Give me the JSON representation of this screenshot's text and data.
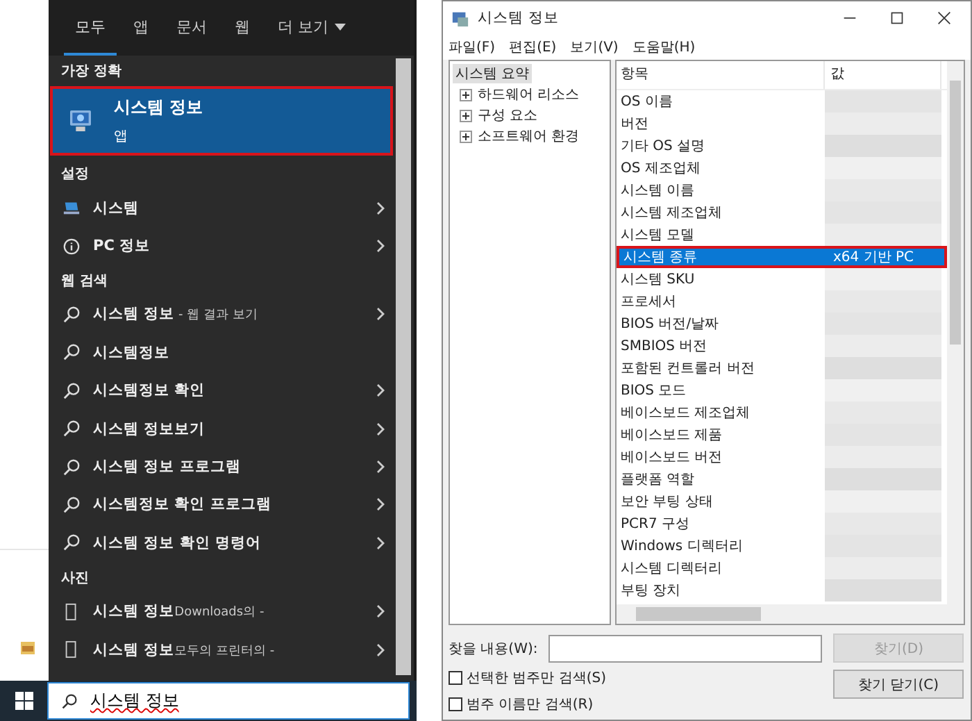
{
  "start_menu": {
    "tabs": [
      {
        "label": "모두",
        "selected": true,
        "kind": "plain"
      },
      {
        "label": "앱",
        "selected": false,
        "kind": "plain"
      },
      {
        "label": "문서",
        "selected": false,
        "kind": "plain"
      },
      {
        "label": "웹",
        "selected": false,
        "kind": "plain"
      },
      {
        "label": "더 보기",
        "selected": false,
        "kind": "menu"
      }
    ],
    "sections": [
      {
        "title": "가장 정확",
        "items": [
          {
            "kind": "app",
            "title": "시스템 정보",
            "subtitle": "앱",
            "highlighted": true
          }
        ]
      },
      {
        "title": "설정",
        "items": [
          {
            "kind": "system",
            "title": "시스템",
            "chevron": true
          },
          {
            "kind": "info",
            "title": "PC 정보",
            "chevron": true
          }
        ]
      },
      {
        "title": "웹 검색",
        "items": [
          {
            "kind": "search",
            "title": "시스템 정보",
            "suffix": " - 웹 결과 보기",
            "chevron": true
          },
          {
            "kind": "search",
            "title": "시스템정보",
            "chevron": false
          },
          {
            "kind": "search",
            "title": "시스템정보 확인",
            "chevron": true
          },
          {
            "kind": "search",
            "title": "시스템 정보보기",
            "chevron": true
          },
          {
            "kind": "search",
            "title": "시스템 정보 프로그램",
            "chevron": true
          },
          {
            "kind": "search",
            "title": "시스템정보 확인 프로그램",
            "chevron": true
          },
          {
            "kind": "search",
            "title": "시스템 정보 확인 명령어",
            "chevron": true
          }
        ]
      },
      {
        "title": "사진",
        "items": [
          {
            "kind": "photo",
            "title": "시스템 정보",
            "suffix": "Downloads의 -",
            "chevron": true
          },
          {
            "kind": "photo",
            "title": "시스템 정보",
            "suffix": "모두의 프린터의 -",
            "chevron": true
          }
        ]
      }
    ]
  },
  "search_box": {
    "value": "시스템 정보"
  },
  "window": {
    "title": "시스템 정보",
    "menu": [
      "파일(F)",
      "편집(E)",
      "보기(V)",
      "도움말(H)"
    ],
    "tree": [
      {
        "label": "시스템 요약",
        "selected": true,
        "expandable": false
      },
      {
        "label": "하드웨어 리소스",
        "selected": false,
        "expandable": true
      },
      {
        "label": "구성 요소",
        "selected": false,
        "expandable": true
      },
      {
        "label": "소프트웨어 환경",
        "selected": false,
        "expandable": true
      }
    ],
    "columns": [
      "항목",
      "값"
    ],
    "rows": [
      {
        "item": "OS 이름",
        "selected": false
      },
      {
        "item": "버전",
        "selected": false
      },
      {
        "item": "기타 OS 설명",
        "selected": false
      },
      {
        "item": "OS 제조업체",
        "selected": false
      },
      {
        "item": "시스템 이름",
        "selected": false
      },
      {
        "item": "시스템 제조업체",
        "selected": false
      },
      {
        "item": "시스템 모델",
        "selected": false
      },
      {
        "item": "시스템 종류",
        "value": "x64 기반 PC",
        "selected": true,
        "highlighted": true
      },
      {
        "item": "시스템 SKU",
        "selected": false
      },
      {
        "item": "프로세서",
        "selected": false
      },
      {
        "item": "BIOS 버전/날짜",
        "selected": false
      },
      {
        "item": "SMBIOS 버전",
        "selected": false
      },
      {
        "item": "포함된 컨트롤러 버전",
        "selected": false
      },
      {
        "item": "BIOS 모드",
        "selected": false
      },
      {
        "item": "베이스보드 제조업체",
        "selected": false
      },
      {
        "item": "베이스보드 제품",
        "selected": false
      },
      {
        "item": "베이스보드 버전",
        "selected": false
      },
      {
        "item": "플랫폼 역할",
        "selected": false
      },
      {
        "item": "보안 부팅 상태",
        "selected": false
      },
      {
        "item": "PCR7 구성",
        "selected": false
      },
      {
        "item": "Windows 디렉터리",
        "selected": false
      },
      {
        "item": "시스템 디렉터리",
        "selected": false
      },
      {
        "item": "부팅 장치",
        "selected": false
      }
    ],
    "find": {
      "label": "찾을 내용(W):",
      "find_button": {
        "label": "찾기(D)",
        "disabled": true
      },
      "close_button": {
        "label": "찾기 닫기(C)",
        "disabled": false
      },
      "checkboxes": [
        {
          "label": "선택한 범주만 검색(S)",
          "checked": false
        },
        {
          "label": "범주 이름만 검색(R)",
          "checked": false
        }
      ]
    }
  }
}
